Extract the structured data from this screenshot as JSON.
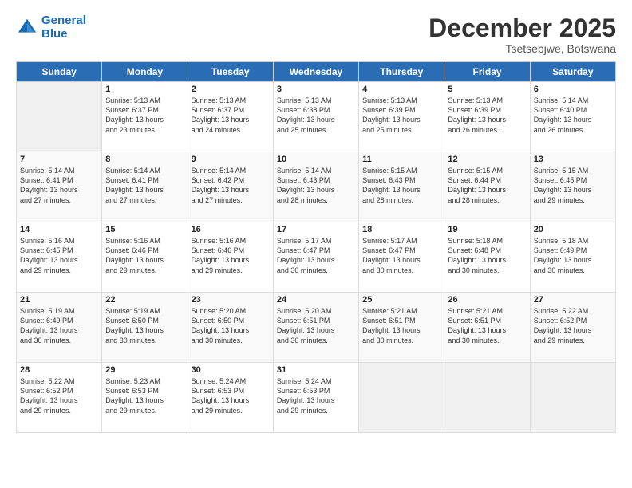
{
  "logo": {
    "line1": "General",
    "line2": "Blue"
  },
  "header": {
    "month": "December 2025",
    "location": "Tsetsebjwe, Botswana"
  },
  "weekdays": [
    "Sunday",
    "Monday",
    "Tuesday",
    "Wednesday",
    "Thursday",
    "Friday",
    "Saturday"
  ],
  "weeks": [
    [
      {
        "day": "",
        "info": ""
      },
      {
        "day": "1",
        "info": "Sunrise: 5:13 AM\nSunset: 6:37 PM\nDaylight: 13 hours\nand 23 minutes."
      },
      {
        "day": "2",
        "info": "Sunrise: 5:13 AM\nSunset: 6:37 PM\nDaylight: 13 hours\nand 24 minutes."
      },
      {
        "day": "3",
        "info": "Sunrise: 5:13 AM\nSunset: 6:38 PM\nDaylight: 13 hours\nand 25 minutes."
      },
      {
        "day": "4",
        "info": "Sunrise: 5:13 AM\nSunset: 6:39 PM\nDaylight: 13 hours\nand 25 minutes."
      },
      {
        "day": "5",
        "info": "Sunrise: 5:13 AM\nSunset: 6:39 PM\nDaylight: 13 hours\nand 26 minutes."
      },
      {
        "day": "6",
        "info": "Sunrise: 5:14 AM\nSunset: 6:40 PM\nDaylight: 13 hours\nand 26 minutes."
      }
    ],
    [
      {
        "day": "7",
        "info": "Sunrise: 5:14 AM\nSunset: 6:41 PM\nDaylight: 13 hours\nand 27 minutes."
      },
      {
        "day": "8",
        "info": "Sunrise: 5:14 AM\nSunset: 6:41 PM\nDaylight: 13 hours\nand 27 minutes."
      },
      {
        "day": "9",
        "info": "Sunrise: 5:14 AM\nSunset: 6:42 PM\nDaylight: 13 hours\nand 27 minutes."
      },
      {
        "day": "10",
        "info": "Sunrise: 5:14 AM\nSunset: 6:43 PM\nDaylight: 13 hours\nand 28 minutes."
      },
      {
        "day": "11",
        "info": "Sunrise: 5:15 AM\nSunset: 6:43 PM\nDaylight: 13 hours\nand 28 minutes."
      },
      {
        "day": "12",
        "info": "Sunrise: 5:15 AM\nSunset: 6:44 PM\nDaylight: 13 hours\nand 28 minutes."
      },
      {
        "day": "13",
        "info": "Sunrise: 5:15 AM\nSunset: 6:45 PM\nDaylight: 13 hours\nand 29 minutes."
      }
    ],
    [
      {
        "day": "14",
        "info": "Sunrise: 5:16 AM\nSunset: 6:45 PM\nDaylight: 13 hours\nand 29 minutes."
      },
      {
        "day": "15",
        "info": "Sunrise: 5:16 AM\nSunset: 6:46 PM\nDaylight: 13 hours\nand 29 minutes."
      },
      {
        "day": "16",
        "info": "Sunrise: 5:16 AM\nSunset: 6:46 PM\nDaylight: 13 hours\nand 29 minutes."
      },
      {
        "day": "17",
        "info": "Sunrise: 5:17 AM\nSunset: 6:47 PM\nDaylight: 13 hours\nand 30 minutes."
      },
      {
        "day": "18",
        "info": "Sunrise: 5:17 AM\nSunset: 6:47 PM\nDaylight: 13 hours\nand 30 minutes."
      },
      {
        "day": "19",
        "info": "Sunrise: 5:18 AM\nSunset: 6:48 PM\nDaylight: 13 hours\nand 30 minutes."
      },
      {
        "day": "20",
        "info": "Sunrise: 5:18 AM\nSunset: 6:49 PM\nDaylight: 13 hours\nand 30 minutes."
      }
    ],
    [
      {
        "day": "21",
        "info": "Sunrise: 5:19 AM\nSunset: 6:49 PM\nDaylight: 13 hours\nand 30 minutes."
      },
      {
        "day": "22",
        "info": "Sunrise: 5:19 AM\nSunset: 6:50 PM\nDaylight: 13 hours\nand 30 minutes."
      },
      {
        "day": "23",
        "info": "Sunrise: 5:20 AM\nSunset: 6:50 PM\nDaylight: 13 hours\nand 30 minutes."
      },
      {
        "day": "24",
        "info": "Sunrise: 5:20 AM\nSunset: 6:51 PM\nDaylight: 13 hours\nand 30 minutes."
      },
      {
        "day": "25",
        "info": "Sunrise: 5:21 AM\nSunset: 6:51 PM\nDaylight: 13 hours\nand 30 minutes."
      },
      {
        "day": "26",
        "info": "Sunrise: 5:21 AM\nSunset: 6:51 PM\nDaylight: 13 hours\nand 30 minutes."
      },
      {
        "day": "27",
        "info": "Sunrise: 5:22 AM\nSunset: 6:52 PM\nDaylight: 13 hours\nand 29 minutes."
      }
    ],
    [
      {
        "day": "28",
        "info": "Sunrise: 5:22 AM\nSunset: 6:52 PM\nDaylight: 13 hours\nand 29 minutes."
      },
      {
        "day": "29",
        "info": "Sunrise: 5:23 AM\nSunset: 6:53 PM\nDaylight: 13 hours\nand 29 minutes."
      },
      {
        "day": "30",
        "info": "Sunrise: 5:24 AM\nSunset: 6:53 PM\nDaylight: 13 hours\nand 29 minutes."
      },
      {
        "day": "31",
        "info": "Sunrise: 5:24 AM\nSunset: 6:53 PM\nDaylight: 13 hours\nand 29 minutes."
      },
      {
        "day": "",
        "info": ""
      },
      {
        "day": "",
        "info": ""
      },
      {
        "day": "",
        "info": ""
      }
    ]
  ]
}
